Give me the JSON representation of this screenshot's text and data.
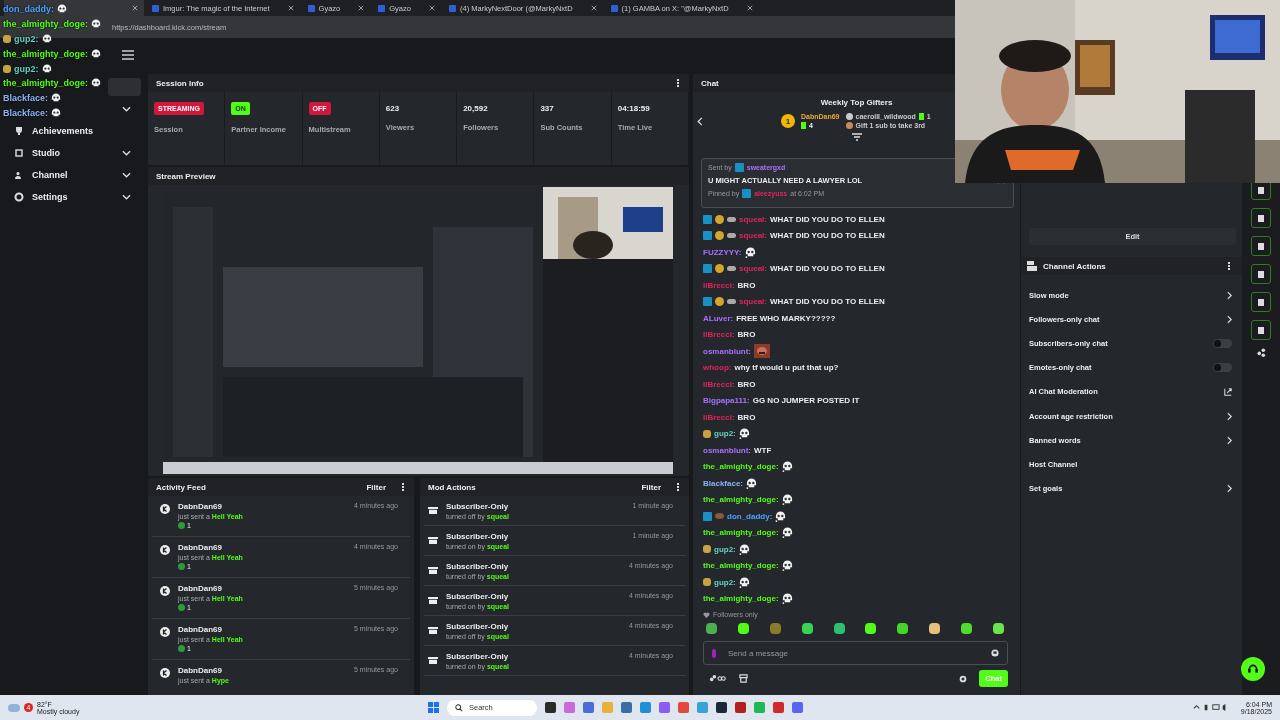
{
  "browser": {
    "tabs": [
      {
        "selected": true
      },
      {
        "label": "Imgur: The magic of the Internet",
        "selected": false
      },
      {
        "label": "Gyazo",
        "selected": false
      },
      {
        "label": "Gyazo",
        "selected": false
      },
      {
        "label": "(4) MarkyNextDoor (@MarkyNxtD",
        "selected": false
      },
      {
        "label": "(1) GAMBA on X: \"@MarkyNxtD",
        "selected": false
      }
    ],
    "url": "https://dashboard.kick.com/stream"
  },
  "chat_overlay": [
    {
      "user": "don_daddy:",
      "color": "#4aa3ff",
      "bread_badge": false
    },
    {
      "user": "the_almighty_doge:",
      "color": "#53fc18",
      "bread_badge": false
    },
    {
      "user": "gup2:",
      "color": "#5fd3c0",
      "bread_badge": true
    },
    {
      "user": "the_almighty_doge:",
      "color": "#53fc18",
      "bread_badge": false
    },
    {
      "user": "gup2:",
      "color": "#5fd3c0",
      "bread_badge": true
    },
    {
      "user": "the_almighty_doge:",
      "color": "#53fc18",
      "bread_badge": false
    },
    {
      "user": "Blackface:",
      "color": "#8ab4f8",
      "bread_badge": false
    },
    {
      "user": "Blackface:",
      "color": "#8ab4f8",
      "bread_badge": false
    }
  ],
  "sidebar": {
    "items": [
      {
        "selected": true,
        "expandable": false
      },
      {
        "selected": false,
        "expandable": true
      },
      {
        "label": "Achievements",
        "selected": false,
        "expandable": false
      },
      {
        "label": "Studio",
        "selected": false,
        "expandable": true
      },
      {
        "label": "Channel",
        "selected": false,
        "expandable": true
      },
      {
        "label": "Settings",
        "selected": false,
        "expandable": true
      }
    ]
  },
  "session_info": {
    "title": "Session Info",
    "stats": [
      {
        "kind": "badge",
        "value": "STREAMING",
        "color": "#d3173c",
        "label": "Session"
      },
      {
        "kind": "badge",
        "value": "ON",
        "color": "#53fc18",
        "label": "Partner Income"
      },
      {
        "kind": "badge",
        "value": "OFF",
        "color": "#d3173c",
        "label": "Multistream"
      },
      {
        "kind": "number",
        "value": "623",
        "label": "Viewers"
      },
      {
        "kind": "number",
        "value": "20,592",
        "label": "Followers"
      },
      {
        "kind": "number",
        "value": "337",
        "label": "Sub Counts"
      },
      {
        "kind": "number",
        "value": "04:18:59",
        "label": "Time Live"
      }
    ]
  },
  "stream_preview": {
    "title": "Stream Preview",
    "kind": "picture"
  },
  "activity_feed": {
    "title": "Activity Feed",
    "filter": "Filter",
    "items": [
      {
        "user": "DabnDan69",
        "action": "just sent a",
        "item": "Hell Yeah",
        "count": "1",
        "time": "4 minutes ago"
      },
      {
        "user": "DabnDan69",
        "action": "just sent a",
        "item": "Hell Yeah",
        "count": "1",
        "time": "4 minutes ago"
      },
      {
        "user": "DabnDan69",
        "action": "just sent a",
        "item": "Hell Yeah",
        "count": "1",
        "time": "5 minutes ago"
      },
      {
        "user": "DabnDan69",
        "action": "just sent a",
        "item": "Hell Yeah",
        "count": "1",
        "time": "5 minutes ago"
      },
      {
        "user": "DabnDan69",
        "action": "just sent a",
        "item": "Hype",
        "time": "5 minutes ago"
      }
    ]
  },
  "mod_actions": {
    "title": "Mod Actions",
    "filter": "Filter",
    "items": [
      {
        "title": "Subscriber-Only",
        "action": "turned off by",
        "user": "squeal",
        "time": "1 minute ago"
      },
      {
        "title": "Subscriber-Only",
        "action": "turned on by",
        "user": "squeal",
        "time": "1 minute ago"
      },
      {
        "title": "Subscriber-Only",
        "action": "turned off by",
        "user": "squeal",
        "time": "4 minutes ago"
      },
      {
        "title": "Subscriber-Only",
        "action": "turned on by",
        "user": "squeal",
        "time": "4 minutes ago"
      },
      {
        "title": "Subscriber-Only",
        "action": "turned off by",
        "user": "squeal",
        "time": "4 minutes ago"
      },
      {
        "title": "Subscriber-Only",
        "action": "turned on by",
        "user": "squeal",
        "time": "4 minutes ago"
      }
    ]
  },
  "chat": {
    "title": "Chat",
    "gifters": {
      "title": "Weekly Top Gifters",
      "first": {
        "rank": "1",
        "name": "DabnDan69",
        "count": "4"
      },
      "second": {
        "name": "caeroill_wildwood",
        "count": "1"
      },
      "third": "Gift 1 sub to take 3rd"
    },
    "pinned": {
      "sent_label": "Sent by",
      "sender": "sweatergxd",
      "message": "U MIGHT ACTUALLY NEED A LAWYER LOL",
      "pinned_label": "Pinned by",
      "pinner": "aleezyuss",
      "time": "at 6:02 PM"
    },
    "messages": [
      {
        "user": "squeal:",
        "color": "#e0245e",
        "badges": [
          {
            "kind": "mod"
          },
          {
            "kind": "coin"
          },
          {
            "kind": "pill"
          }
        ],
        "kind": "text",
        "text": "WHAT DID YOU DO TO ELLEN"
      },
      {
        "user": "squeal:",
        "color": "#e0245e",
        "badges": [
          {
            "kind": "mod"
          },
          {
            "kind": "coin"
          },
          {
            "kind": "pill"
          }
        ],
        "kind": "text",
        "text": "WHAT DID YOU DO TO ELLEN"
      },
      {
        "user": "FUZZYYY:",
        "color": "#a970ff",
        "kind": "skull"
      },
      {
        "user": "squeal:",
        "color": "#e0245e",
        "badges": [
          {
            "kind": "mod"
          },
          {
            "kind": "coin"
          },
          {
            "kind": "pill"
          }
        ],
        "kind": "text",
        "text": "WHAT DID YOU DO TO ELLEN"
      },
      {
        "user": "llBrecci:",
        "color": "#e0245e",
        "kind": "text",
        "text": "BRO"
      },
      {
        "user": "squeal:",
        "color": "#e0245e",
        "badges": [
          {
            "kind": "mod"
          },
          {
            "kind": "coin"
          },
          {
            "kind": "pill"
          }
        ],
        "kind": "text",
        "text": "WHAT DID YOU DO TO ELLEN"
      },
      {
        "user": "ALuver:",
        "color": "#a970ff",
        "kind": "text",
        "text": "FREE WHO MARKY?????"
      },
      {
        "user": "llBrecci:",
        "color": "#e0245e",
        "kind": "text",
        "text": "BRO"
      },
      {
        "user": "osmanblunt:",
        "color": "#a970ff"
      },
      {
        "user": "whoop:",
        "color": "#e0245e",
        "kind": "text",
        "text": "why tf would u put that up?"
      },
      {
        "user": "llBrecci:",
        "color": "#e0245e",
        "kind": "text",
        "text": "BRO"
      },
      {
        "user": "Bigpapa111:",
        "color": "#a970ff",
        "kind": "text",
        "text": "GG NO JUMPER POSTED IT"
      },
      {
        "user": "llBrecci:",
        "color": "#e0245e",
        "kind": "text",
        "text": "BRO"
      },
      {
        "user": "gup2:",
        "color": "#5fd3c0",
        "badges": [
          {
            "kind": "bread"
          }
        ],
        "kind": "skull"
      },
      {
        "user": "osmanblunt:",
        "color": "#a970ff",
        "kind": "text",
        "text": "WTF"
      },
      {
        "user": "the_almighty_doge:",
        "color": "#53fc18",
        "kind": "skull"
      },
      {
        "user": "Blackface:",
        "color": "#8ab4f8",
        "kind": "skull"
      },
      {
        "user": "the_almighty_doge:",
        "color": "#53fc18",
        "kind": "skull"
      },
      {
        "user": "don_daddy:",
        "color": "#4aa3ff",
        "badges": [
          {
            "kind": "mod"
          },
          {
            "kind": "football"
          }
        ],
        "kind": "skull"
      },
      {
        "user": "the_almighty_doge:",
        "color": "#53fc18",
        "kind": "skull"
      },
      {
        "user": "gup2:",
        "color": "#5fd3c0",
        "badges": [
          {
            "kind": "bread"
          }
        ],
        "kind": "skull"
      },
      {
        "user": "the_almighty_doge:",
        "color": "#53fc18",
        "kind": "skull"
      },
      {
        "user": "gup2:",
        "color": "#5fd3c0",
        "badges": [
          {
            "kind": "bread"
          }
        ],
        "kind": "skull"
      },
      {
        "user": "the_almighty_doge:",
        "color": "#53fc18",
        "kind": "skull"
      }
    ],
    "mode_note": "Followers only",
    "input": {
      "placeholder": "Send a message"
    },
    "send": "Chat"
  },
  "channel_panel": {
    "edit": "Edit",
    "title": "Channel Actions",
    "actions": [
      {
        "label": "Slow mode",
        "kind": "arrow"
      },
      {
        "label": "Followers-only chat",
        "kind": "arrow"
      },
      {
        "label": "Subscribers-only chat",
        "kind": "toggle",
        "on": false
      },
      {
        "label": "Emotes-only chat",
        "kind": "toggle",
        "on": false
      },
      {
        "label": "AI Chat Moderation",
        "kind": "external"
      },
      {
        "label": "Account age restriction",
        "kind": "arrow"
      },
      {
        "label": "Banned words",
        "kind": "arrow"
      },
      {
        "label": "Host Channel",
        "kind": "plain"
      },
      {
        "label": "Set goals",
        "kind": "arrow"
      }
    ]
  },
  "taskbar": {
    "weather_badge": "4",
    "temperature": "82°F",
    "weather": "Mostly cloudy",
    "search": "Search",
    "time": "6:04 PM",
    "date": "9/18/2025"
  }
}
